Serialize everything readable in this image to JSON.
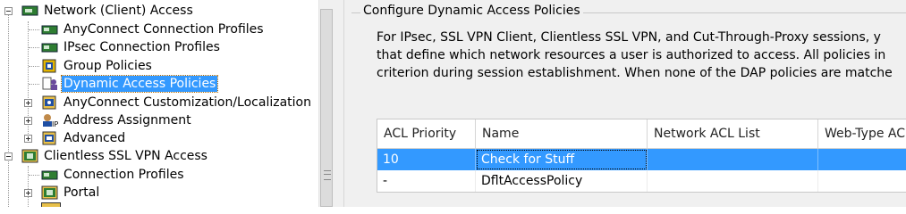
{
  "tree": {
    "items": [
      {
        "label": "Network (Client) Access",
        "icon": "network-access-icon"
      },
      {
        "label": "AnyConnect Connection Profiles",
        "icon": "connection-profile-icon"
      },
      {
        "label": "IPsec Connection Profiles",
        "icon": "connection-profile-icon"
      },
      {
        "label": "Group Policies",
        "icon": "group-policy-icon"
      },
      {
        "label": "Dynamic Access Policies",
        "icon": "dynamic-access-policy-icon",
        "selected": true
      },
      {
        "label": "AnyConnect Customization/Localization",
        "icon": "customization-icon"
      },
      {
        "label": "Address Assignment",
        "icon": "address-assignment-icon"
      },
      {
        "label": "Advanced",
        "icon": "advanced-icon"
      },
      {
        "label": "Clientless SSL VPN Access",
        "icon": "clientless-access-icon"
      },
      {
        "label": "Connection Profiles",
        "icon": "connection-profile-icon"
      },
      {
        "label": "Portal",
        "icon": "portal-icon"
      }
    ]
  },
  "panel": {
    "title": "Configure Dynamic Access Policies",
    "description": [
      "For IPsec, SSL VPN Client, Clientless SSL VPN, and Cut-Through-Proxy sessions, y",
      "that define which network resources a user is authorized to access. All policies in",
      "criterion during session establishment. When none of the DAP policies are matche"
    ]
  },
  "table": {
    "columns": [
      "ACL Priority",
      "Name",
      "Network ACL List",
      "Web-Type AC"
    ],
    "rows": [
      {
        "priority": "10",
        "name": "Check for Stuff",
        "network_acl": "",
        "web_acl": "",
        "selected": true
      },
      {
        "priority": "-",
        "name": "DfltAccessPolicy",
        "network_acl": "",
        "web_acl": "",
        "selected": false
      }
    ]
  },
  "colors": {
    "selection": "#3399ff",
    "panel_background": "#f0f0f0"
  }
}
